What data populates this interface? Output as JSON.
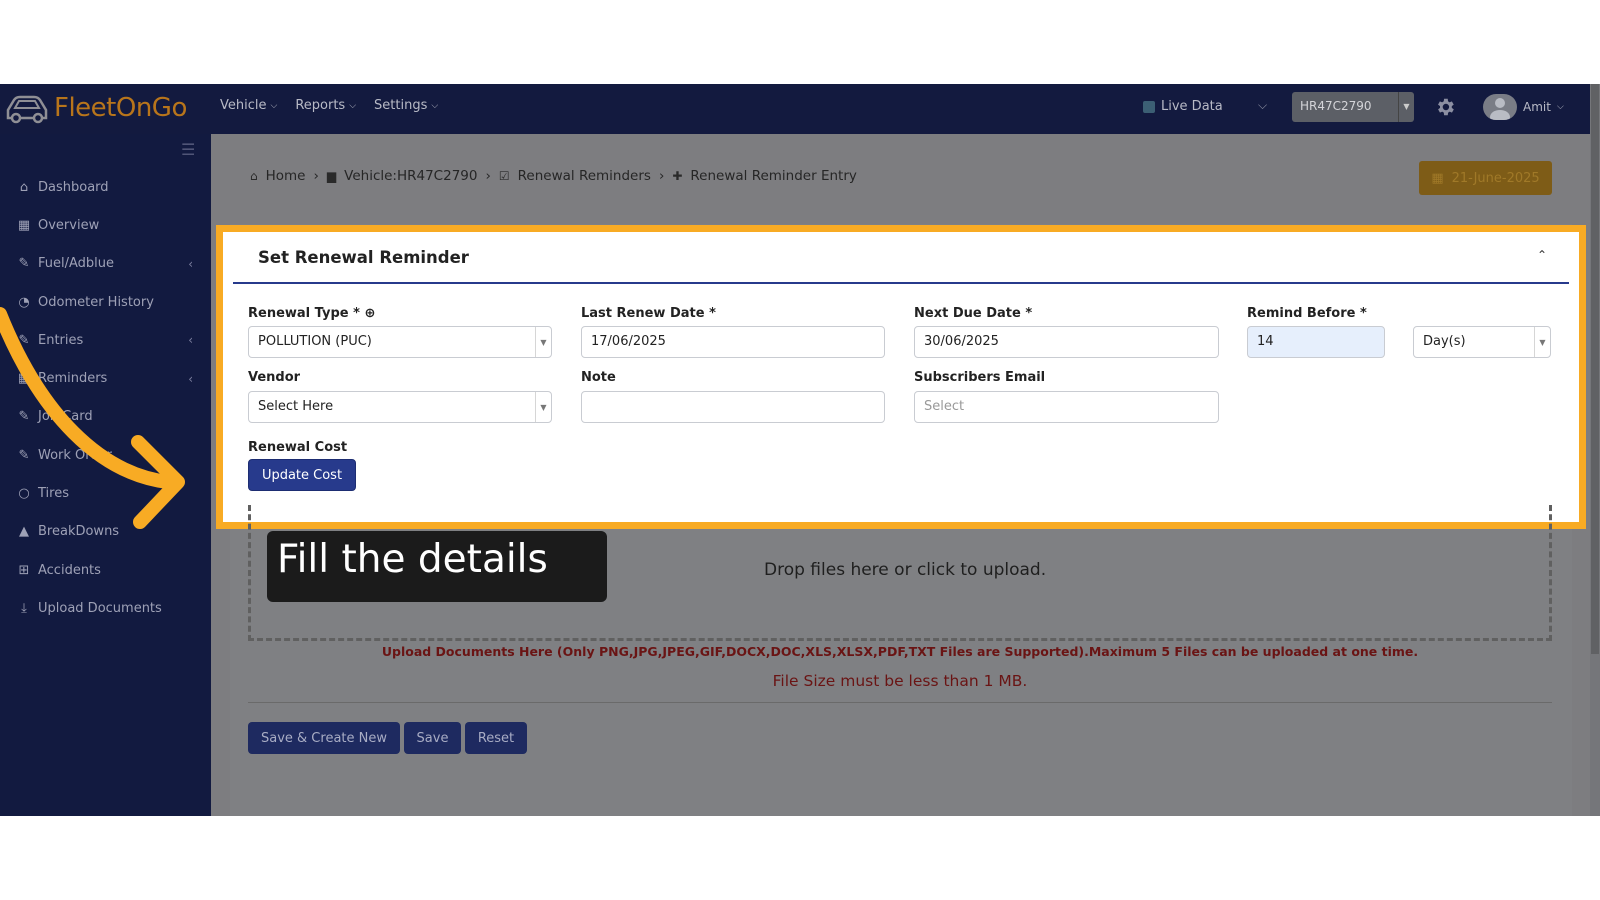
{
  "app": {
    "brand": "FleetOnGo"
  },
  "nav": {
    "menus": [
      "Vehicle",
      "Reports",
      "Settings"
    ],
    "live_data": "Live Data",
    "vehicle_select": "HR47C2790",
    "user": "Amit"
  },
  "sidebar": {
    "items": [
      {
        "label": "Dashboard",
        "icon": "home-icon",
        "glyph": "⌂",
        "arrow": ""
      },
      {
        "label": "Overview",
        "icon": "grid-icon",
        "glyph": "▦",
        "arrow": ""
      },
      {
        "label": "Fuel/Adblue",
        "icon": "edit-icon",
        "glyph": "✎",
        "arrow": "‹"
      },
      {
        "label": "Odometer History",
        "icon": "tachometer-icon",
        "glyph": "◔",
        "arrow": ""
      },
      {
        "label": "Entries",
        "icon": "edit-icon",
        "glyph": "✎",
        "arrow": "‹"
      },
      {
        "label": "Reminders",
        "icon": "calendar-icon",
        "glyph": "▦",
        "arrow": "‹"
      },
      {
        "label": "Job Card",
        "icon": "edit-icon",
        "glyph": "✎",
        "arrow": ""
      },
      {
        "label": "Work Order",
        "icon": "edit-icon",
        "glyph": "✎",
        "arrow": ""
      },
      {
        "label": "Tires",
        "icon": "circle-icon",
        "glyph": "○",
        "arrow": ""
      },
      {
        "label": "BreakDowns",
        "icon": "warning-icon",
        "glyph": "▲",
        "arrow": ""
      },
      {
        "label": "Accidents",
        "icon": "plus-square-icon",
        "glyph": "⊞",
        "arrow": ""
      },
      {
        "label": "Upload Documents",
        "icon": "download-icon",
        "glyph": "⤓",
        "arrow": ""
      }
    ]
  },
  "breadcrumb": {
    "items": [
      "Home",
      "Vehicle:HR47C2790",
      "Renewal Reminders",
      "Renewal Reminder Entry"
    ],
    "separator": "›",
    "date": "21-June-2025"
  },
  "form": {
    "title": "Set Renewal Reminder",
    "renewal_type_label": "Renewal Type *",
    "renewal_type_value": "POLLUTION (PUC)",
    "last_renew_label": "Last Renew Date *",
    "last_renew_value": "17/06/2025",
    "next_due_label": "Next Due Date *",
    "next_due_value": "30/06/2025",
    "remind_before_label": "Remind Before *",
    "remind_before_value": "14",
    "remind_unit_value": "Day(s)",
    "vendor_label": "Vendor",
    "vendor_value": "Select Here",
    "note_label": "Note",
    "note_value": "",
    "subscribers_label": "Subscribers Email",
    "subscribers_placeholder": "Select",
    "renewal_cost_label": "Renewal Cost",
    "update_cost_button": "Update Cost"
  },
  "upload": {
    "drop_text": "Drop files here or click to upload.",
    "note": "Upload Documents Here (Only PNG,JPG,JPEG,GIF,DOCX,DOC,XLS,XLSX,PDF,TXT Files are Supported).Maximum 5 Files can be uploaded at one time.",
    "size_note": "File Size must be less than 1 MB."
  },
  "actions": {
    "save_create_new": "Save & Create New",
    "save": "Save",
    "reset": "Reset"
  },
  "overlay": {
    "callout_text": "Fill the details",
    "highlight_color": "#f8ab24",
    "arrow_color": "#f8ab24"
  },
  "colors": {
    "navbar": "#131a3f",
    "sidebar": "#121a40",
    "brand_orange": "#b8751b",
    "primary_button": "#273a8c",
    "error_text": "#6a1414"
  }
}
